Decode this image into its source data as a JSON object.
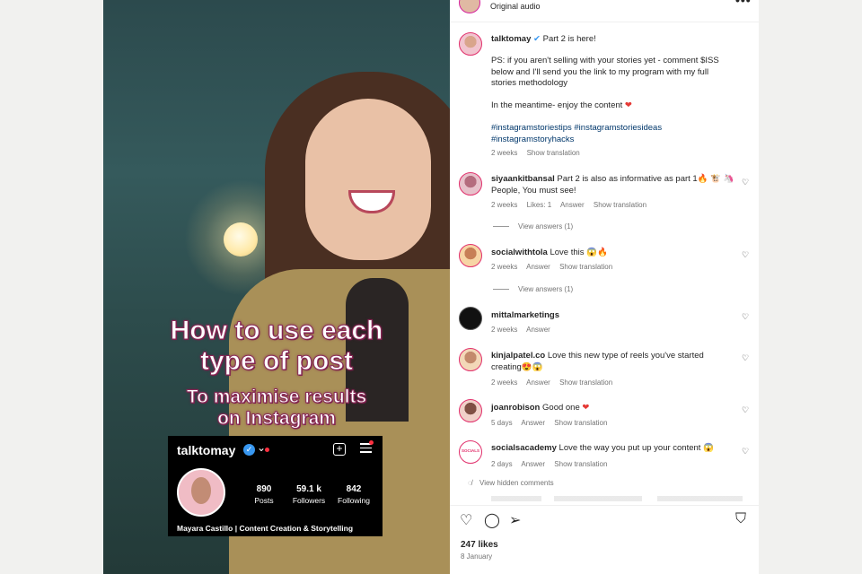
{
  "media": {
    "overlay_title_line1": "How to use each",
    "overlay_title_line2": "type of post",
    "overlay_sub_line1": "To maximise results",
    "overlay_sub_line2": "on Instagram",
    "profile_card": {
      "username": "talktomay",
      "stats": [
        {
          "num": "890",
          "label": "Posts"
        },
        {
          "num": "59.1 k",
          "label": "Followers"
        },
        {
          "num": "842",
          "label": "Following"
        }
      ],
      "full_name": "Mayara Castillo | Content Creation & Storytelling"
    }
  },
  "header": {
    "audio_label": "Original audio",
    "more_icon": "•••"
  },
  "caption": {
    "username": "talktomay",
    "headline": "Part 2 is here!",
    "para1": "PS: if you aren't selling with your stories yet - comment $ISS below and I'll send you the link to my program with my full stories methodology",
    "para2": "In the meantime- enjoy the content ",
    "heart": "❤",
    "hashtags": "#instagramstoriestips #instagramstoriesideas #instagramstoryhacks",
    "time": "2 weeks",
    "show_translation": "Show translation"
  },
  "comments": [
    {
      "user": "siyaankitbansal",
      "text": "Part 2 is also as informative as part 1🔥 🐮 🦄 People, You must see!",
      "time": "2 weeks",
      "likes": "Likes: 1",
      "answer": "Answer",
      "translate": "Show translation",
      "view_answers": "View answers (1)"
    },
    {
      "user": "socialwithtola",
      "text": "Love this 😱🔥",
      "time": "2 weeks",
      "answer": "Answer",
      "translate": "Show translation",
      "view_answers": "View answers (1)"
    },
    {
      "user": "mittalmarketings",
      "text": "",
      "time": "2 weeks",
      "answer": "Answer"
    },
    {
      "user": "kinjalpatel.co",
      "text": "Love this new type of reels you've started creating😍😱",
      "time": "2 weeks",
      "answer": "Answer",
      "translate": "Show translation"
    },
    {
      "user": "joanrobison",
      "text": "Good one ",
      "heart": "❤",
      "time": "5 days",
      "answer": "Answer",
      "translate": "Show translation"
    },
    {
      "user": "socialsacademy",
      "text": "Love the way you put up your content 😱",
      "time": "2 days",
      "answer": "Answer",
      "translate": "Show translation",
      "avatar_text": "SOCIALS"
    }
  ],
  "hidden_comments": "View hidden comments",
  "footer": {
    "likes": "247 likes",
    "date": "8 January"
  }
}
